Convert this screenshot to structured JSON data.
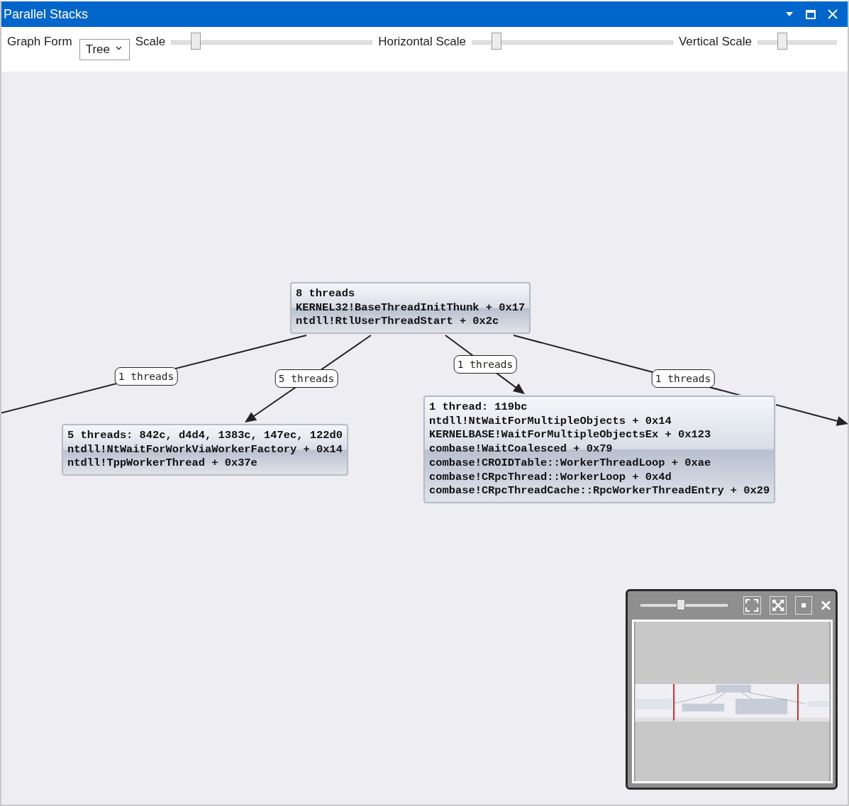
{
  "window": {
    "title": "Parallel Stacks"
  },
  "toolbar": {
    "graph_form": {
      "label": "Graph Form",
      "value": "Tree"
    },
    "sliders": [
      {
        "label": "Scale",
        "level": 0.12
      },
      {
        "label": "Horizontal Scale",
        "level": 0.12
      },
      {
        "label": "Vertical Scale",
        "level": 0.31
      }
    ]
  },
  "graph": {
    "nodes": [
      {
        "header": "8 threads",
        "frames": [
          "KERNEL32!BaseThreadInitThunk + 0x17",
          "ntdll!RtlUserThreadStart + 0x2c"
        ]
      },
      {
        "header": "5 threads: 842c, d4d4, 1383c, 147ec, 122d0",
        "frames": [
          "ntdll!NtWaitForWorkViaWorkerFactory + 0x14",
          "ntdll!TppWorkerThread + 0x37e"
        ]
      },
      {
        "header": "1 thread: 119bc",
        "frames": [
          "ntdll!NtWaitForMultipleObjects + 0x14",
          "KERNELBASE!WaitForMultipleObjectsEx + 0x123",
          "combase!WaitCoalesced + 0x79",
          "combase!CROIDTable::WorkerThreadLoop + 0xae",
          "combase!CRpcThread::WorkerLoop + 0x4d",
          "combase!CRpcThreadCache::RpcWorkerThreadEntry + 0x29"
        ]
      }
    ],
    "edges": [
      {
        "label": "1 threads",
        "arrowhead": false
      },
      {
        "label": "5 threads",
        "arrowhead": true
      },
      {
        "label": "1 threads",
        "arrowhead": true
      },
      {
        "label": "1 threads",
        "arrowhead": true
      }
    ]
  },
  "minimap": {
    "zoom": {
      "level": 0.46
    }
  }
}
